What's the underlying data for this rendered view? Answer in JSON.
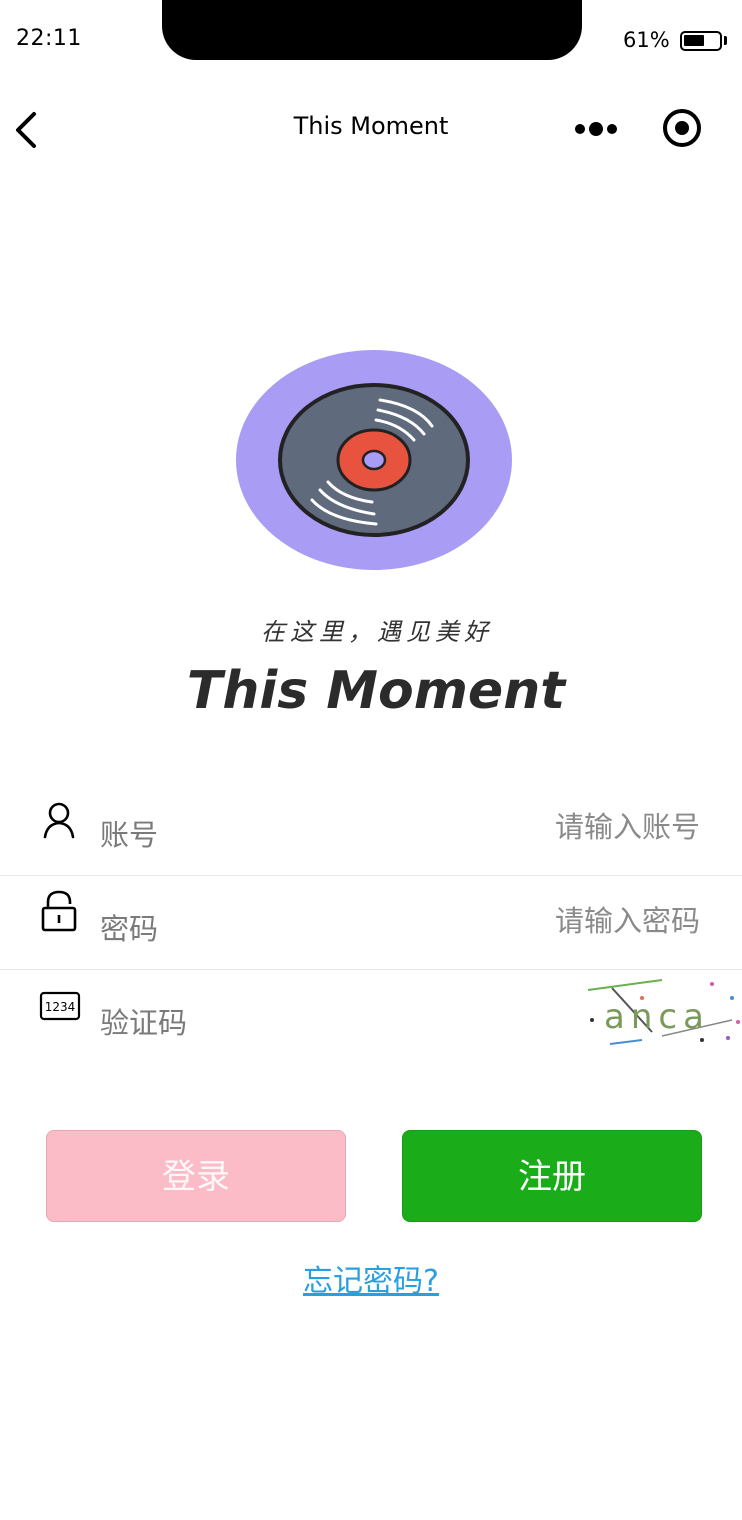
{
  "status_bar": {
    "time": "22:11",
    "battery_percent": "61%",
    "battery_level": 0.61
  },
  "nav": {
    "title": "This Moment",
    "back_icon": "chevron-left-icon",
    "more_icon": "more-dots-icon",
    "close_icon": "capsule-close-icon"
  },
  "logo": {
    "slogan": "在这里，遇见美好",
    "brand": "This Moment",
    "icon": "vinyl-record-icon"
  },
  "form": {
    "account": {
      "label": "账号",
      "placeholder": "请输入账号",
      "value": "",
      "icon": "user-icon"
    },
    "password": {
      "label": "密码",
      "placeholder": "请输入密码",
      "value": "",
      "icon": "lock-icon"
    },
    "captcha": {
      "label": "验证码",
      "placeholder": "",
      "value": "",
      "icon": "number-code-icon",
      "image_text": "anca"
    }
  },
  "buttons": {
    "login": "登录",
    "register": "注册"
  },
  "links": {
    "forgot_password": "忘记密码?"
  },
  "colors": {
    "login_bg": "#fbbcc8",
    "register_bg": "#1aad19",
    "link": "#2a9fe0",
    "disc_bg": "#a89cf5"
  }
}
